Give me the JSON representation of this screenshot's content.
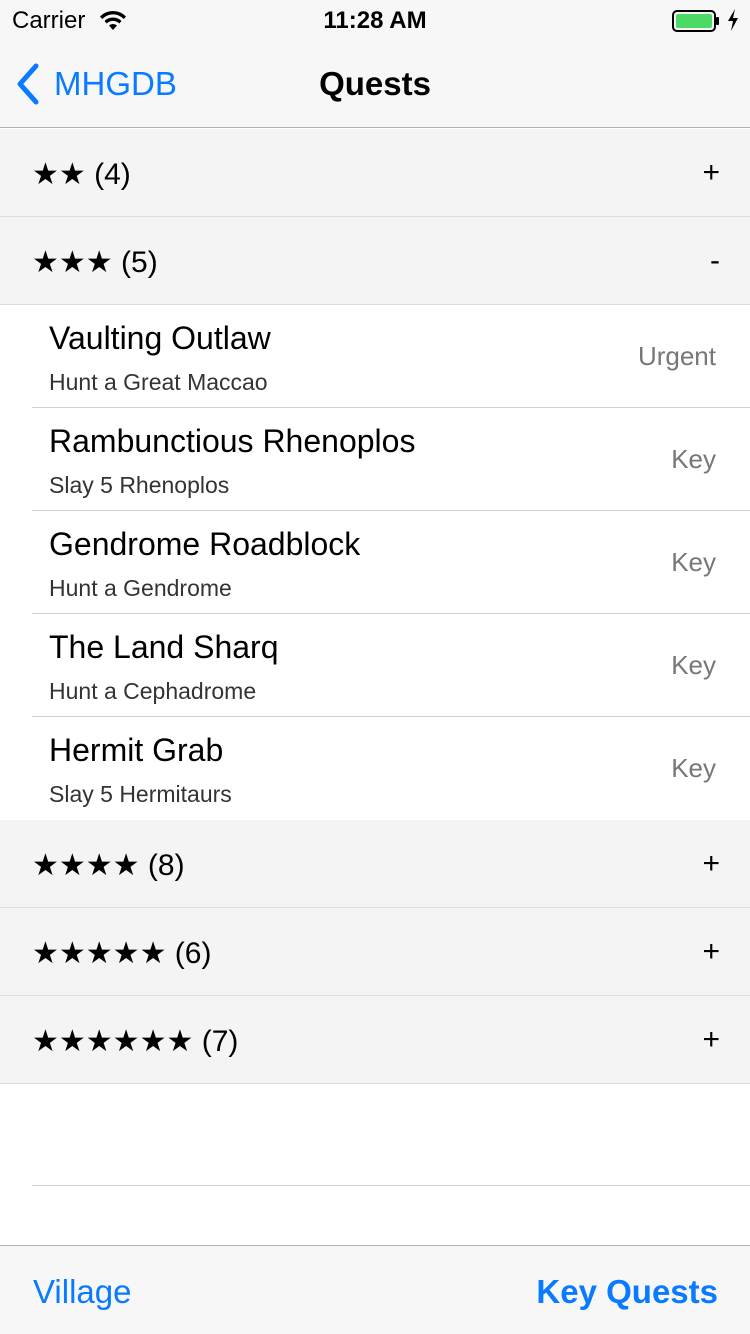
{
  "status": {
    "carrier": "Carrier",
    "time": "11:28 AM"
  },
  "nav": {
    "back_label": "MHGDB",
    "title": "Quests"
  },
  "sections": [
    {
      "label": "★★ (4)",
      "toggle": "+",
      "expanded": false,
      "rows": []
    },
    {
      "label": "★★★ (5)",
      "toggle": "-",
      "expanded": true,
      "rows": [
        {
          "title": "Vaulting Outlaw",
          "subtitle": "Hunt a Great Maccao",
          "type": "Urgent"
        },
        {
          "title": "Rambunctious Rhenoplos",
          "subtitle": "Slay 5 Rhenoplos",
          "type": "Key"
        },
        {
          "title": "Gendrome Roadblock",
          "subtitle": "Hunt a Gendrome",
          "type": "Key"
        },
        {
          "title": "The Land Sharq",
          "subtitle": "Hunt a Cephadrome",
          "type": "Key"
        },
        {
          "title": "Hermit Grab",
          "subtitle": "Slay 5 Hermitaurs",
          "type": "Key"
        }
      ]
    },
    {
      "label": "★★★★ (8)",
      "toggle": "+",
      "expanded": false,
      "rows": []
    },
    {
      "label": "★★★★★ (6)",
      "toggle": "+",
      "expanded": false,
      "rows": []
    },
    {
      "label": "★★★★★★ (7)",
      "toggle": "+",
      "expanded": false,
      "rows": []
    }
  ],
  "toolbar": {
    "left_label": "Village",
    "right_label": "Key Quests"
  },
  "colors": {
    "accent": "#0a7aff",
    "battery": "#4cd964"
  },
  "icons": {
    "back": "chevron-left-icon",
    "wifi": "wifi-icon",
    "battery": "battery-icon",
    "charging": "bolt-icon"
  }
}
